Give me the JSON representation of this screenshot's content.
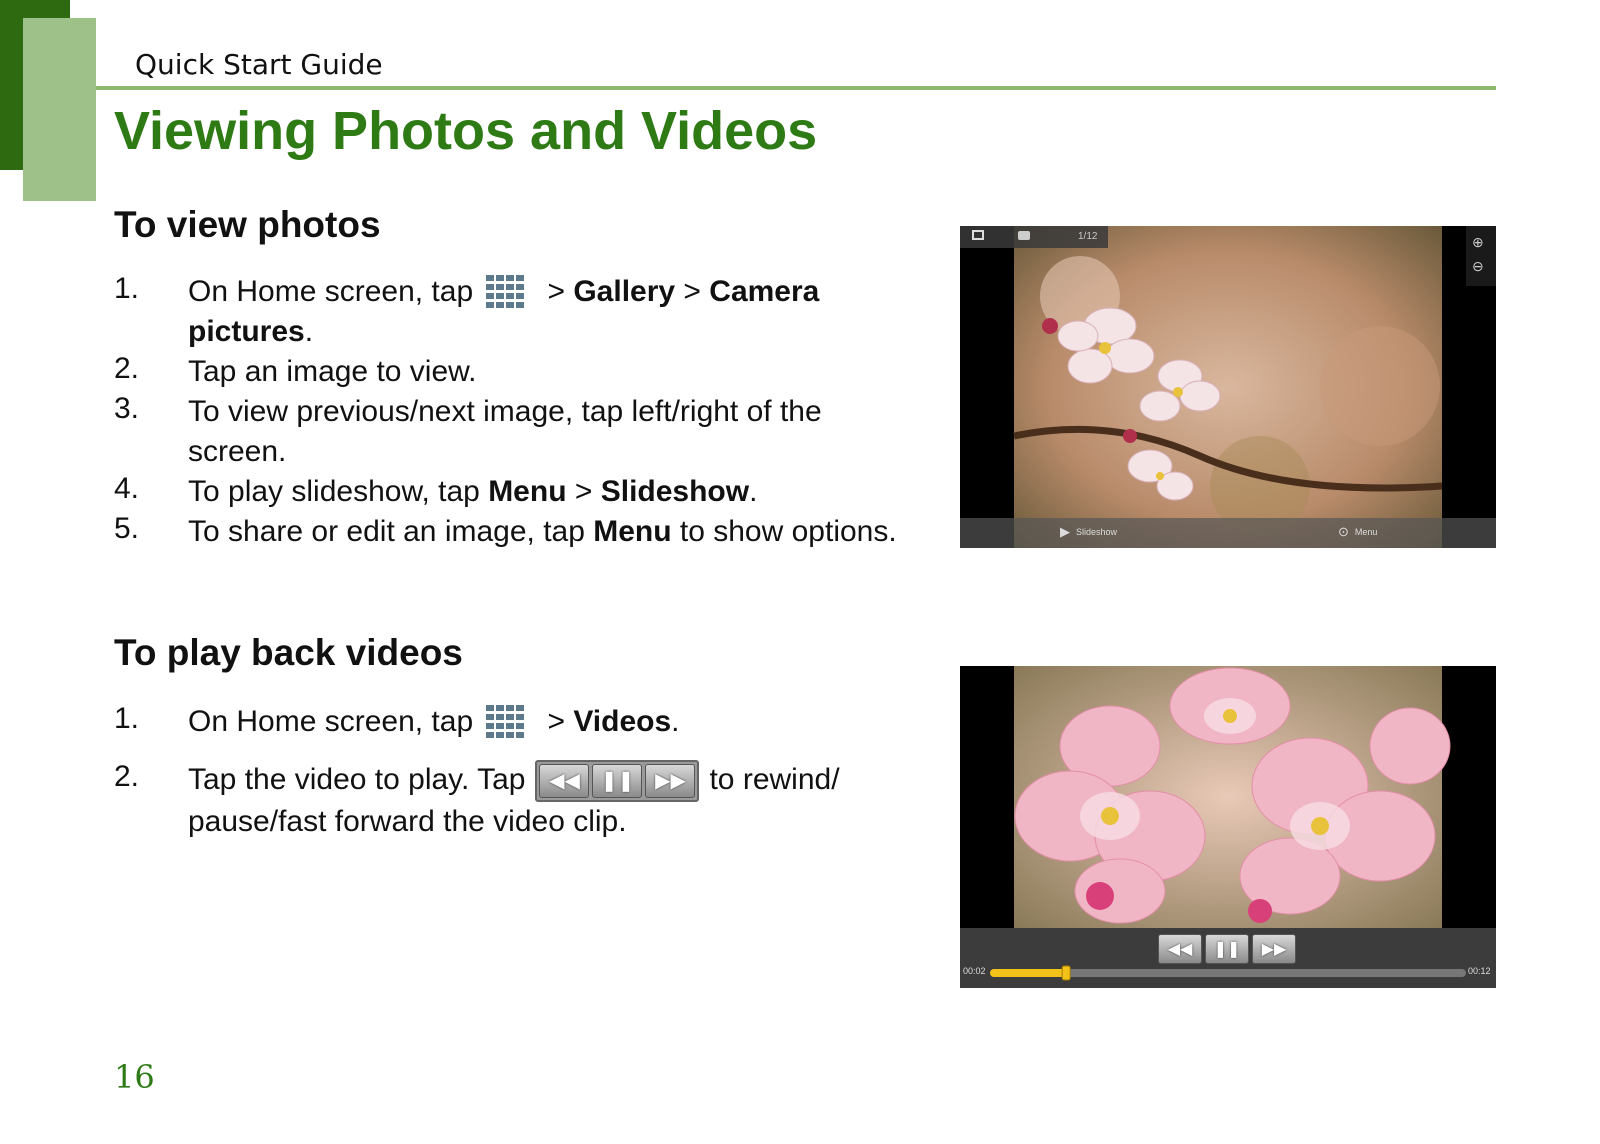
{
  "header": {
    "running_title": "Quick Start Guide"
  },
  "page_title": "Viewing Photos and Videos",
  "photos_section": {
    "heading": "To view photos",
    "steps": [
      {
        "num": "1.",
        "parts": [
          "On Home screen, tap ",
          "[apps-icon]",
          " > ",
          "Gallery",
          " > ",
          "Camera pictures",
          "."
        ]
      },
      {
        "num": "2.",
        "text": "Tap an image to view."
      },
      {
        "num": "3.",
        "text": "To view previous/next image, tap left/right of the screen."
      },
      {
        "num": "4.",
        "parts": [
          "To play slideshow, tap ",
          "Menu",
          " > ",
          "Slideshow",
          "."
        ]
      },
      {
        "num": "5.",
        "parts": [
          "To share or edit an image, tap ",
          "Menu",
          " to show options."
        ]
      }
    ],
    "step1_a": "On Home screen, tap",
    "step1_b": " > ",
    "step1_gallery": "Gallery",
    "step1_c": " > ",
    "step1_camera": "Camera pictures",
    "step1_d": ".",
    "step4_a": "To play slideshow, tap ",
    "step4_menu": "Menu",
    "step4_b": " > ",
    "step4_slideshow": "Slideshow",
    "step4_c": ".",
    "step5_a": "To share or edit an image, tap ",
    "step5_menu": "Menu",
    "step5_b": " to show options."
  },
  "videos_section": {
    "heading": "To play back videos",
    "step1_num": "1.",
    "step1_a": "On Home screen, tap",
    "step1_b": " > ",
    "step1_videos": "Videos",
    "step1_c": ".",
    "step2_num": "2.",
    "step2_a": "Tap the video to play. Tap",
    "step2_b": "to rewind/ pause/fast forward the video clip."
  },
  "gallery_screenshot": {
    "counter": "1/12",
    "slideshow_label": "Slideshow",
    "menu_label": "Menu"
  },
  "video_screenshot": {
    "elapsed": "00:02",
    "duration": "00:12",
    "progress": 0.16
  },
  "page_number": "16",
  "colors": {
    "brand_green": "#2e7a14",
    "rule_green": "#8bbb6a",
    "progress_yellow": "#f2c21a"
  },
  "icons": [
    "apps-grid-icon",
    "rewind-icon",
    "pause-icon",
    "fast-forward-icon",
    "play-icon",
    "menu-icon",
    "zoom-in-icon",
    "zoom-out-icon",
    "gallery-icon",
    "camera-icon"
  ]
}
